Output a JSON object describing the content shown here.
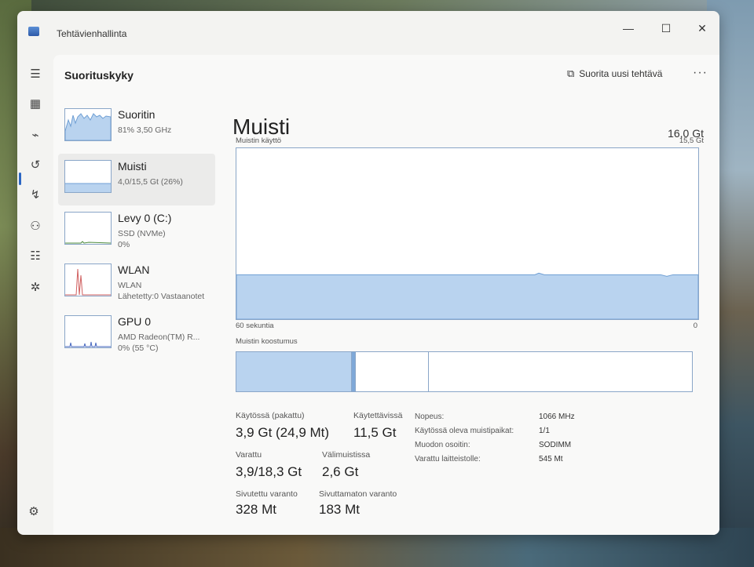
{
  "window": {
    "title": "Tehtävienhallinta",
    "minimize": "—",
    "maximize": "☐",
    "close": "✕"
  },
  "nav": {
    "items": [
      "hamburger-icon",
      "processes-icon",
      "performance-icon",
      "history-icon",
      "startup-icon",
      "users-icon",
      "details-icon",
      "services-icon"
    ],
    "settings_icon": "gear-icon"
  },
  "header": {
    "title": "Suorituskyky",
    "run_task": "Suorita uusi tehtävä",
    "more": "···"
  },
  "devices": [
    {
      "name": "Suoritin",
      "sub1": "81%  3,50 GHz",
      "sub2": ""
    },
    {
      "name": "Muisti",
      "sub1": "4,0/15,5 Gt (26%)",
      "sub2": ""
    },
    {
      "name": "Levy 0 (C:)",
      "sub1": "SSD (NVMe)",
      "sub2": "0%"
    },
    {
      "name": "WLAN",
      "sub1": "WLAN",
      "sub2": "Lähetetty:0 Vastaanotet"
    },
    {
      "name": "GPU 0",
      "sub1": "AMD Radeon(TM) R...",
      "sub2": "0%  (55 °C)"
    }
  ],
  "memory": {
    "title": "Muisti",
    "total": "16,0 Gt",
    "usage_label": "Muistin käyttö",
    "usage_max": "15,5 Gt",
    "time_left": "60 sekuntia",
    "time_right": "0",
    "usage_fraction": 0.26,
    "composition_label": "Muistin koostumus",
    "stats": {
      "in_use_label": "Käytössä (pakattu)",
      "in_use": "3,9 Gt (24,9 Mt)",
      "available_label": "Käytettävissä",
      "available": "11,5 Gt",
      "committed_label": "Varattu",
      "committed": "3,9/18,3 Gt",
      "cached_label": "Välimuistissa",
      "cached": "2,6 Gt",
      "paged_label": "Sivutettu varanto",
      "paged": "328 Mt",
      "nonpaged_label": "Sivuttamaton varanto",
      "nonpaged": "183 Mt"
    },
    "details": [
      {
        "k": "Nopeus:",
        "v": "1066 MHz"
      },
      {
        "k": "Käytössä oleva muistipaikat:",
        "v": "1/1"
      },
      {
        "k": "Muodon osoitin:",
        "v": "SODIMM"
      },
      {
        "k": "Varattu laitteistolle:",
        "v": "545 Mt"
      }
    ]
  },
  "colors": {
    "accent": "#2b66c4",
    "graph_fill": "#b9d3ef",
    "graph_line": "#6f9fd4",
    "wlan_spike": "#d06060"
  }
}
